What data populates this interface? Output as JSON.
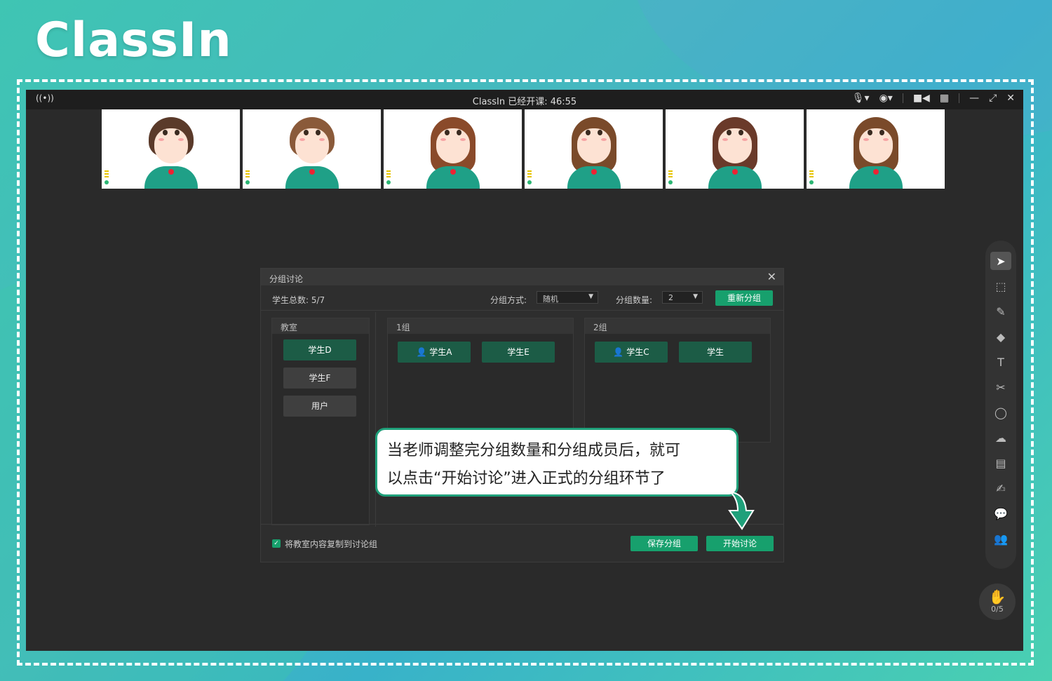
{
  "brand": {
    "logo_text": "ClassIn"
  },
  "titlebar": {
    "title": "ClassIn   已经开课: 46:55",
    "icons": [
      "live-icon",
      "mic-icon",
      "camera-icon",
      "video-icon",
      "grid-icon",
      "minimize-icon",
      "fullscreen-icon",
      "close-icon"
    ]
  },
  "videos": [
    {
      "hair": "#5a3a2a",
      "gender": "m"
    },
    {
      "hair": "#8a5a3a",
      "gender": "m"
    },
    {
      "hair": "#8a4a2a",
      "gender": "f"
    },
    {
      "hair": "#7a4a2a",
      "gender": "f"
    },
    {
      "hair": "#6a3a2a",
      "gender": "f"
    },
    {
      "hair": "#7a4a2a",
      "gender": "f"
    }
  ],
  "dialog": {
    "title": "分组讨论",
    "student_total": "学生总数: 5/7",
    "mode_label": "分组方式:",
    "mode_value": "随机",
    "count_label": "分组数量:",
    "count_value": "2",
    "regroup_label": "重新分组",
    "classroom": {
      "title": "教室",
      "students": [
        "学生D",
        "学生F",
        "用户"
      ]
    },
    "groups": [
      {
        "title": "1组",
        "members": [
          "学生A",
          "学生E"
        ]
      },
      {
        "title": "2组",
        "members": [
          "学生C",
          "学生"
        ]
      }
    ],
    "copy_content_label": "将教室内容复制到讨论组",
    "save_label": "保存分组",
    "start_label": "开始讨论"
  },
  "raise_hand": {
    "count": "0/5"
  },
  "callout": {
    "line1": "当老师调整完分组数量和分组成员后，就可",
    "line2": "以点击“开始讨论”进入正式的分组环节了"
  },
  "colors": {
    "accent": "#17a06d",
    "bubble_border": "#1fa07a"
  }
}
